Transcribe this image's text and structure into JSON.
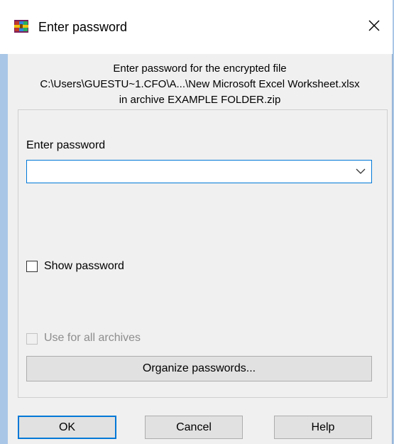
{
  "window": {
    "title": "Enter password"
  },
  "info": {
    "line1": "Enter password for the encrypted file",
    "line2": "C:\\Users\\GUESTU~1.CFO\\A...\\New Microsoft Excel Worksheet.xlsx",
    "line3": "in archive EXAMPLE FOLDER.zip"
  },
  "form": {
    "password_label": "Enter password",
    "password_value": "",
    "show_password_label": "Show password",
    "show_password_checked": false,
    "use_for_all_label": "Use for all archives",
    "use_for_all_checked": false,
    "use_for_all_enabled": false,
    "organize_label": "Organize passwords..."
  },
  "buttons": {
    "ok": "OK",
    "cancel": "Cancel",
    "help": "Help"
  },
  "colors": {
    "accent": "#0078d7",
    "background": "#f0f0f0",
    "desktop": "#a9c6e6"
  },
  "icons": {
    "app": "winrar-icon",
    "close": "close-icon",
    "dropdown": "chevron-down-icon"
  }
}
